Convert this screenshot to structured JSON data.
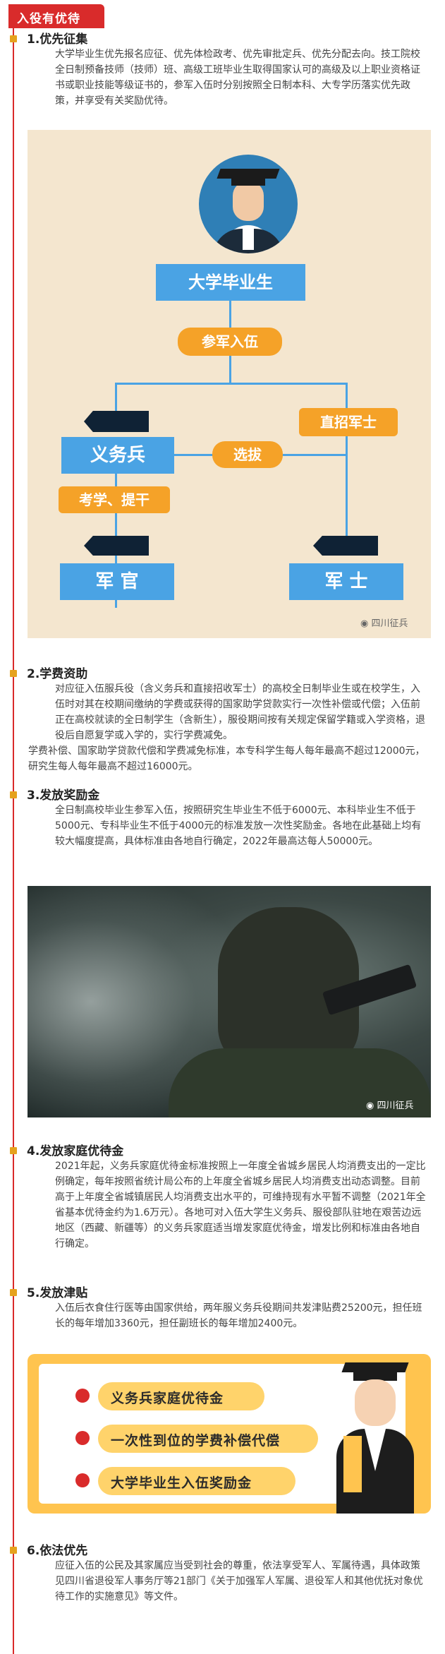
{
  "header": {
    "title": "入役有优待"
  },
  "sections": [
    {
      "title": "1.优先征集",
      "text": "大学毕业生优先报名应征、优先体检政考、优先审批定兵、优先分配去向。技工院校全日制预备技师（技师）班、高级工班毕业生取得国家认可的高级及以上职业资格证书或职业技能等级证书的，参军入伍时分别按照全日制本科、大专学历落实优先政策，并享受有关奖励优待。"
    },
    {
      "title": "2.学费资助",
      "text": "对应征入伍服兵役（含义务兵和直接招收军士）的高校全日制毕业生或在校学生，入伍时对其在校期间缴纳的学费或获得的国家助学贷款实行一次性补偿或代偿；入伍前正在高校就读的全日制学生（含新生），服役期间按有关规定保留学籍或入学资格，退役后自愿复学或入学的，实行学费减免。",
      "text2": "学费补偿、国家助学贷款代偿和学费减免标准，本专科学生每人每年最高不超过12000元，研究生每人每年最高不超过16000元。"
    },
    {
      "title": "3.发放奖励金",
      "text": "全日制高校毕业生参军入伍，按照研究生毕业生不低于6000元、本科毕业生不低于5000元、专科毕业生不低于4000元的标准发放一次性奖励金。各地在此基础上均有较大幅度提高，具体标准由各地自行确定，2022年最高达每人50000元。"
    },
    {
      "title": "4.发放家庭优待金",
      "text": "2021年起，义务兵家庭优待金标准按照上一年度全省城乡居民人均消费支出的一定比例确定，每年按照省统计局公布的上年度全省城乡居民人均消费支出动态调整。目前高于上年度全省城镇居民人均消费支出水平的，可维持现有水平暂不调整（2021年全省基本优待金约为1.6万元）。各地可对入伍大学生义务兵、服役部队驻地在艰苦边远地区（西藏、新疆等）的义务兵家庭适当增发家庭优待金，增发比例和标准由各地自行确定。"
    },
    {
      "title": "5.发放津贴",
      "text": "入伍后衣食住行医等由国家供给，两年服义务兵役期间共发津贴费25200元，担任班长的每年增加3360元，担任副班长的每年增加2400元。"
    },
    {
      "title": "6.依法优先",
      "text": "应征入伍的公民及其家属应当受到社会的尊重，依法享受军人、军属待遇，具体政策见四川省退役军人事务厅等21部门《关于加强军人军属、退役军人和其他优抚对象优待工作的实施意见》等文件。"
    }
  ],
  "flowchart": {
    "top": "大学毕业生",
    "enlist": "参军入伍",
    "left": "义务兵",
    "right": "直招军士",
    "select": "选拔",
    "exam": "考学、提干",
    "officer": "军 官",
    "nco": "军 士"
  },
  "watermark": "四川征兵",
  "banner": {
    "items": [
      "义务兵家庭优待金",
      "一次性到位的学费补偿代偿",
      "大学毕业生入伍奖励金"
    ]
  },
  "colors": {
    "accent_red": "#d92b2b",
    "section_marker": "#e5a21e",
    "flow_blue": "#4aa3e4",
    "flow_orange": "#f5a228",
    "banner_yellow": "#ffc44f"
  }
}
